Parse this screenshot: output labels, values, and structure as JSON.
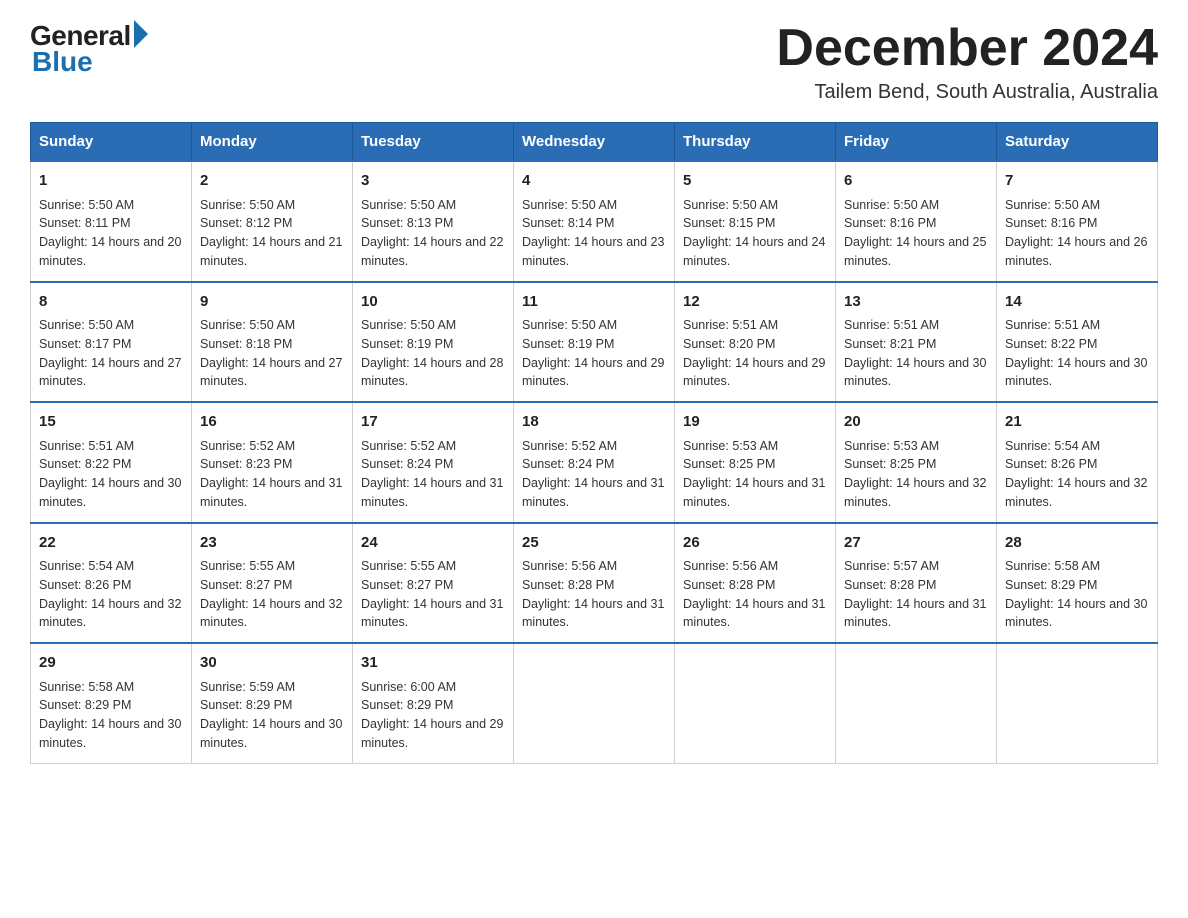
{
  "logo": {
    "general": "General",
    "blue": "Blue"
  },
  "title": "December 2024",
  "subtitle": "Tailem Bend, South Australia, Australia",
  "days_of_week": [
    "Sunday",
    "Monday",
    "Tuesday",
    "Wednesday",
    "Thursday",
    "Friday",
    "Saturday"
  ],
  "weeks": [
    [
      {
        "day": "1",
        "sunrise": "5:50 AM",
        "sunset": "8:11 PM",
        "daylight": "14 hours and 20 minutes."
      },
      {
        "day": "2",
        "sunrise": "5:50 AM",
        "sunset": "8:12 PM",
        "daylight": "14 hours and 21 minutes."
      },
      {
        "day": "3",
        "sunrise": "5:50 AM",
        "sunset": "8:13 PM",
        "daylight": "14 hours and 22 minutes."
      },
      {
        "day": "4",
        "sunrise": "5:50 AM",
        "sunset": "8:14 PM",
        "daylight": "14 hours and 23 minutes."
      },
      {
        "day": "5",
        "sunrise": "5:50 AM",
        "sunset": "8:15 PM",
        "daylight": "14 hours and 24 minutes."
      },
      {
        "day": "6",
        "sunrise": "5:50 AM",
        "sunset": "8:16 PM",
        "daylight": "14 hours and 25 minutes."
      },
      {
        "day": "7",
        "sunrise": "5:50 AM",
        "sunset": "8:16 PM",
        "daylight": "14 hours and 26 minutes."
      }
    ],
    [
      {
        "day": "8",
        "sunrise": "5:50 AM",
        "sunset": "8:17 PM",
        "daylight": "14 hours and 27 minutes."
      },
      {
        "day": "9",
        "sunrise": "5:50 AM",
        "sunset": "8:18 PM",
        "daylight": "14 hours and 27 minutes."
      },
      {
        "day": "10",
        "sunrise": "5:50 AM",
        "sunset": "8:19 PM",
        "daylight": "14 hours and 28 minutes."
      },
      {
        "day": "11",
        "sunrise": "5:50 AM",
        "sunset": "8:19 PM",
        "daylight": "14 hours and 29 minutes."
      },
      {
        "day": "12",
        "sunrise": "5:51 AM",
        "sunset": "8:20 PM",
        "daylight": "14 hours and 29 minutes."
      },
      {
        "day": "13",
        "sunrise": "5:51 AM",
        "sunset": "8:21 PM",
        "daylight": "14 hours and 30 minutes."
      },
      {
        "day": "14",
        "sunrise": "5:51 AM",
        "sunset": "8:22 PM",
        "daylight": "14 hours and 30 minutes."
      }
    ],
    [
      {
        "day": "15",
        "sunrise": "5:51 AM",
        "sunset": "8:22 PM",
        "daylight": "14 hours and 30 minutes."
      },
      {
        "day": "16",
        "sunrise": "5:52 AM",
        "sunset": "8:23 PM",
        "daylight": "14 hours and 31 minutes."
      },
      {
        "day": "17",
        "sunrise": "5:52 AM",
        "sunset": "8:24 PM",
        "daylight": "14 hours and 31 minutes."
      },
      {
        "day": "18",
        "sunrise": "5:52 AM",
        "sunset": "8:24 PM",
        "daylight": "14 hours and 31 minutes."
      },
      {
        "day": "19",
        "sunrise": "5:53 AM",
        "sunset": "8:25 PM",
        "daylight": "14 hours and 31 minutes."
      },
      {
        "day": "20",
        "sunrise": "5:53 AM",
        "sunset": "8:25 PM",
        "daylight": "14 hours and 32 minutes."
      },
      {
        "day": "21",
        "sunrise": "5:54 AM",
        "sunset": "8:26 PM",
        "daylight": "14 hours and 32 minutes."
      }
    ],
    [
      {
        "day": "22",
        "sunrise": "5:54 AM",
        "sunset": "8:26 PM",
        "daylight": "14 hours and 32 minutes."
      },
      {
        "day": "23",
        "sunrise": "5:55 AM",
        "sunset": "8:27 PM",
        "daylight": "14 hours and 32 minutes."
      },
      {
        "day": "24",
        "sunrise": "5:55 AM",
        "sunset": "8:27 PM",
        "daylight": "14 hours and 31 minutes."
      },
      {
        "day": "25",
        "sunrise": "5:56 AM",
        "sunset": "8:28 PM",
        "daylight": "14 hours and 31 minutes."
      },
      {
        "day": "26",
        "sunrise": "5:56 AM",
        "sunset": "8:28 PM",
        "daylight": "14 hours and 31 minutes."
      },
      {
        "day": "27",
        "sunrise": "5:57 AM",
        "sunset": "8:28 PM",
        "daylight": "14 hours and 31 minutes."
      },
      {
        "day": "28",
        "sunrise": "5:58 AM",
        "sunset": "8:29 PM",
        "daylight": "14 hours and 30 minutes."
      }
    ],
    [
      {
        "day": "29",
        "sunrise": "5:58 AM",
        "sunset": "8:29 PM",
        "daylight": "14 hours and 30 minutes."
      },
      {
        "day": "30",
        "sunrise": "5:59 AM",
        "sunset": "8:29 PM",
        "daylight": "14 hours and 30 minutes."
      },
      {
        "day": "31",
        "sunrise": "6:00 AM",
        "sunset": "8:29 PM",
        "daylight": "14 hours and 29 minutes."
      },
      null,
      null,
      null,
      null
    ]
  ]
}
